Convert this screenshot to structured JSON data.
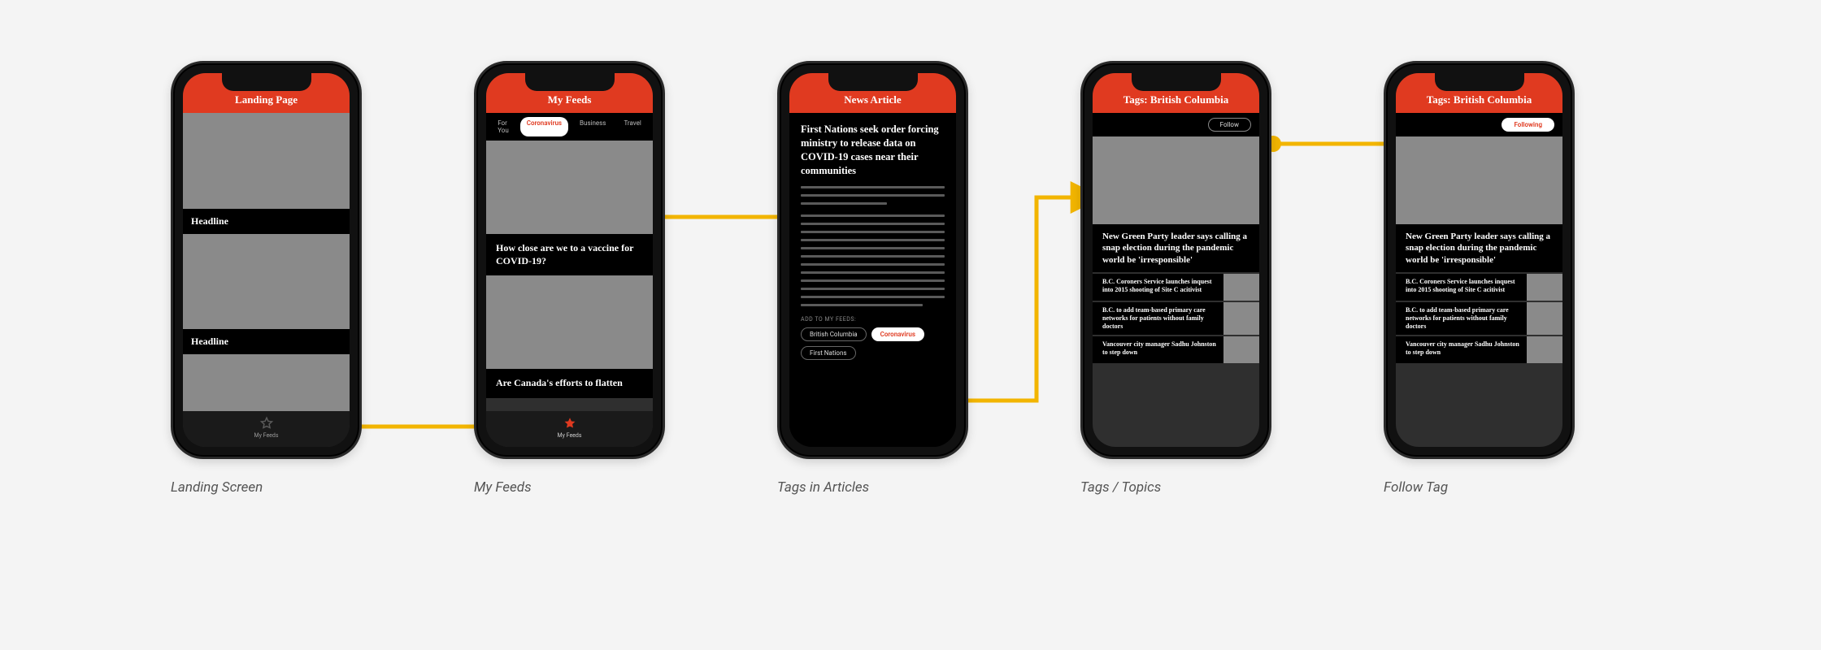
{
  "screens": {
    "landing": {
      "header": "Landing Page",
      "headline1": "Headline",
      "headline2": "Headline",
      "tab_label": "My Feeds"
    },
    "feeds": {
      "header": "My Feeds",
      "segments": [
        "For You",
        "Coronavirus",
        "Business",
        "Travel"
      ],
      "active_segment": "Coronavirus",
      "story1": "How close are we to a vaccine for COVID-19?",
      "story2": "Are Canada's efforts to flatten",
      "tab_label": "My Feeds"
    },
    "article": {
      "header": "News Article",
      "title": "First Nations seek order forcing ministry to release data on COVID-19 cases near their communities",
      "add_label": "ADD TO MY FEEDS:",
      "tags": [
        "British Columbia",
        "Coronavirus",
        "First Nations"
      ],
      "active_tag": "Coronavirus"
    },
    "tag1": {
      "header": "Tags: British Columbia",
      "follow_label": "Follow",
      "lead": "New Green Party leader says calling a snap election during the pandemic world be 'irresponsible'",
      "items": [
        "B.C. Coroners Service launches inquest into 2015 shooting of Site C acitivist",
        "B.C. to add team-based primary care networks for patients without family doctors",
        "Vancouver city manager Sadhu Johnston to step down"
      ]
    },
    "tag2": {
      "header": "Tags: British Columbia",
      "follow_label": "Following",
      "lead": "New Green Party leader says calling a snap election during the pandemic world be 'irresponsible'",
      "items": [
        "B.C. Coroners Service launches inquest into 2015 shooting of Site C acitivist",
        "B.C. to add team-based primary care networks for patients without family doctors",
        "Vancouver city manager Sadhu Johnston to step down"
      ]
    }
  },
  "captions": {
    "c1": "Landing Screen",
    "c2": "My Feeds",
    "c3": "Tags in Articles",
    "c4": "Tags / Topics",
    "c5": "Follow Tag"
  }
}
